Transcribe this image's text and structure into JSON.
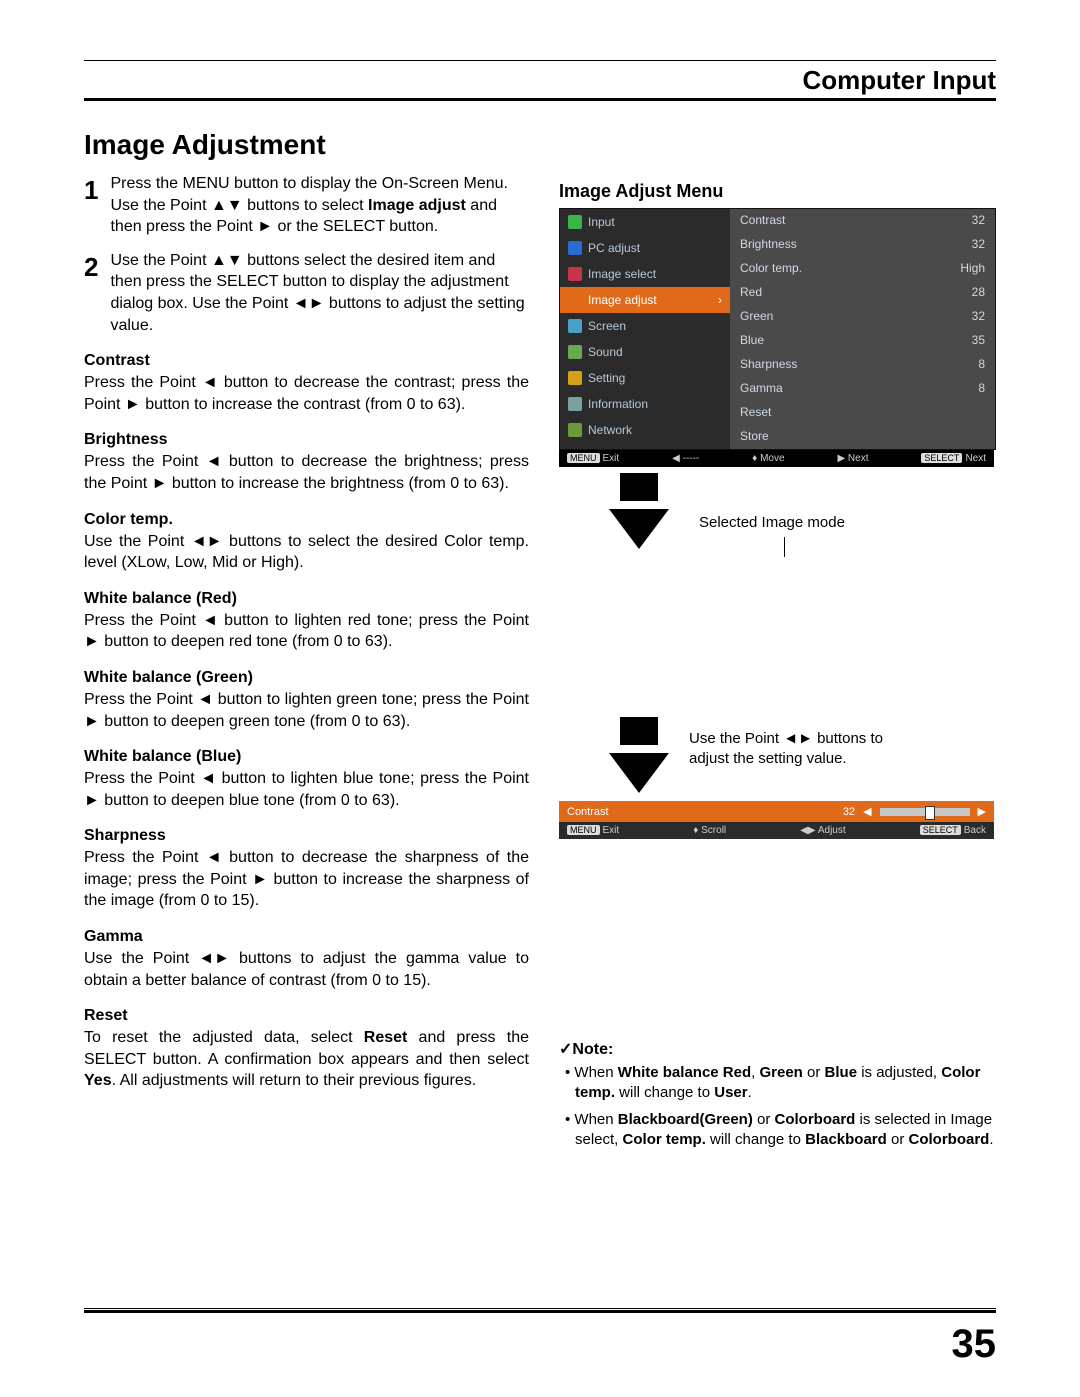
{
  "header": {
    "title": "Computer Input"
  },
  "page_number": "35",
  "section_title": "Image Adjustment",
  "steps": [
    {
      "num": "1",
      "text_parts": [
        "Press the MENU button to display the On-Screen Menu. Use the Point ▲▼ buttons to select ",
        "Image adjust",
        " and then press the Point ► or the SELECT button."
      ]
    },
    {
      "num": "2",
      "text": "Use the Point ▲▼ buttons select the desired item and then press the SELECT button to display the adjustment dialog box. Use the Point ◄► buttons to adjust the setting value."
    }
  ],
  "items": [
    {
      "head": "Contrast",
      "text": "Press the Point ◄ button to decrease the contrast; press the Point ► button to increase the contrast (from 0 to 63)."
    },
    {
      "head": "Brightness",
      "text": "Press the Point ◄ button to decrease the brightness; press the Point ► button to increase the brightness (from 0 to 63)."
    },
    {
      "head": "Color temp.",
      "text": "Use the Point ◄► buttons to select the desired Color temp. level (XLow, Low, Mid or High)."
    },
    {
      "head": "White balance (Red)",
      "text": "Press the Point ◄ button to lighten red tone; press the Point ► button to deepen red tone (from 0 to 63)."
    },
    {
      "head": "White balance (Green)",
      "text": "Press the Point ◄ button to lighten green tone; press the Point ► button to deepen green tone (from 0 to 63)."
    },
    {
      "head": "White balance (Blue)",
      "text": "Press the Point ◄ button to lighten blue tone; press the Point ► button to deepen blue tone (from 0 to 63)."
    },
    {
      "head": "Sharpness",
      "text": "Press the Point ◄ button to decrease the sharpness of the image; press the Point ► button to increase the sharpness of the image (from 0 to 15)."
    },
    {
      "head": "Gamma",
      "text": "Use the Point ◄► buttons to adjust the gamma value to obtain a better balance of contrast (from 0 to 15)."
    }
  ],
  "reset": {
    "head": "Reset",
    "parts": [
      "To reset the adjusted data, select ",
      "Reset",
      " and press the SELECT button. A confirmation box appears and then select ",
      "Yes",
      ". All adjustments will return to their previous figures."
    ]
  },
  "right": {
    "title": "Image Adjust Menu",
    "osd_left": [
      {
        "label": "Input",
        "icon": "#3bb44a"
      },
      {
        "label": "PC adjust",
        "icon": "#2a6bd4"
      },
      {
        "label": "Image select",
        "icon": "#c8324b"
      },
      {
        "label": "Image adjust",
        "icon": "#e06a1a",
        "selected": true
      },
      {
        "label": "Screen",
        "icon": "#4aa0c8"
      },
      {
        "label": "Sound",
        "icon": "#6aa84f"
      },
      {
        "label": "Setting",
        "icon": "#d4a017"
      },
      {
        "label": "Information",
        "icon": "#7aa0a0"
      },
      {
        "label": "Network",
        "icon": "#6a9a3a"
      }
    ],
    "osd_right": [
      {
        "label": "Contrast",
        "value": "32"
      },
      {
        "label": "Brightness",
        "value": "32"
      },
      {
        "label": "Color temp.",
        "value": "High"
      },
      {
        "label": "Red",
        "value": "28"
      },
      {
        "label": "Green",
        "value": "32"
      },
      {
        "label": "Blue",
        "value": "35"
      },
      {
        "label": "Sharpness",
        "value": "8"
      },
      {
        "label": "Gamma",
        "value": "8"
      },
      {
        "label": "Reset",
        "value": ""
      },
      {
        "label": "Store",
        "value": ""
      }
    ],
    "osd_footer": {
      "exit": "Exit",
      "back": "-----",
      "move": "Move",
      "next": "Next",
      "select_next": "Next",
      "menu_label": "MENU",
      "select_label": "SELECT"
    },
    "annot1": "Selected Image mode",
    "annot2": "Use the Point ◄► buttons to adjust the setting value.",
    "slider": {
      "label": "Contrast",
      "value": "32"
    },
    "slider_footer": {
      "exit": "Exit",
      "scroll": "Scroll",
      "adjust": "Adjust",
      "back": "Back"
    }
  },
  "note": {
    "head": "✓Note:",
    "bullets": [
      {
        "parts": [
          "When ",
          "White balance Red",
          ", ",
          "Green",
          " or ",
          "Blue",
          " is adjusted, ",
          "Color temp.",
          " will change to ",
          "User",
          "."
        ]
      },
      {
        "parts": [
          "When ",
          "Blackboard(Green)",
          " or ",
          "Colorboard",
          " is selected in Image select, ",
          "Color temp.",
          " will change to ",
          "Blackboard",
          " or ",
          "Colorboard",
          "."
        ]
      }
    ]
  }
}
